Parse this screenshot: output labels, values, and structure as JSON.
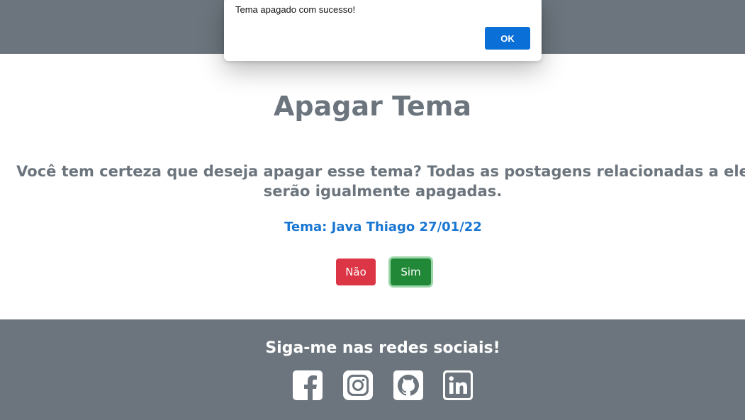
{
  "alert": {
    "message": "Tema apagado com sucesso!",
    "ok_label": "OK"
  },
  "main": {
    "title": "Apagar Tema",
    "confirm_text": "Você tem certeza que deseja apagar esse tema? Todas as postagens relacionadas a ele serão igualmente apagadas.",
    "topic_label": "Tema: Java Thiago 27/01/22",
    "no_label": "Não",
    "yes_label": "Sim"
  },
  "footer": {
    "title": "Siga-me nas redes sociais!",
    "social_icons": [
      "facebook-icon",
      "instagram-icon",
      "github-icon",
      "linkedin-icon"
    ]
  },
  "colors": {
    "header_footer": "#6c757d",
    "title_text": "#6c757d",
    "topic_text": "#1976d2",
    "no_button": "#dc3545",
    "yes_button": "#218838",
    "ok_button": "#0a6fd6"
  }
}
